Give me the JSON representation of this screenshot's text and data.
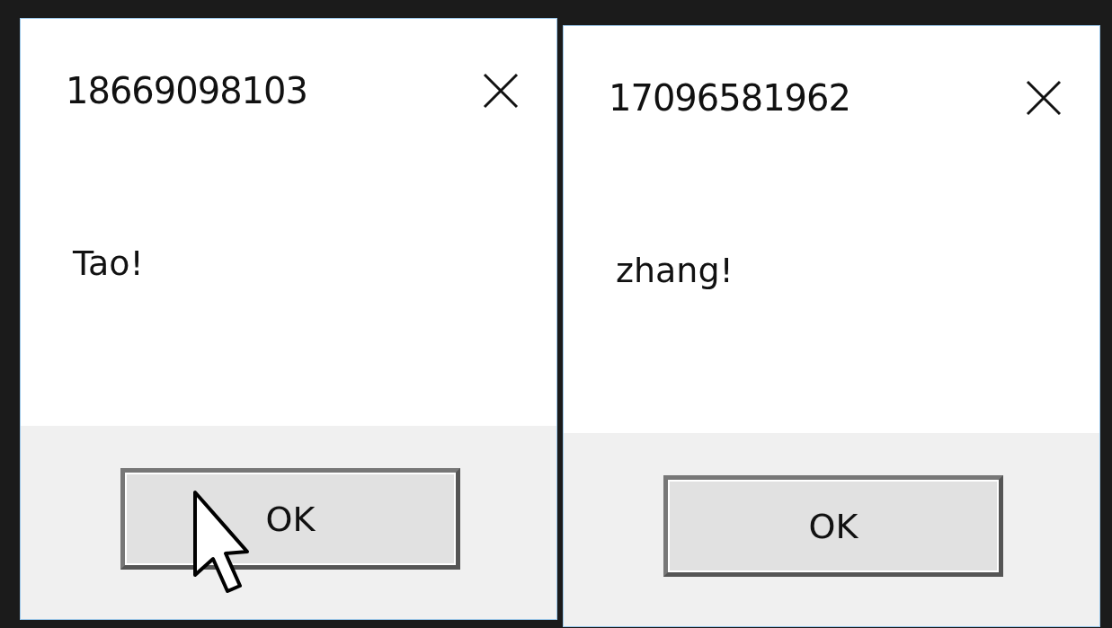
{
  "dialogs": [
    {
      "title": "18669098103",
      "message": "Tao!",
      "button": "OK",
      "cursor_over_button": true
    },
    {
      "title": "17096581962",
      "message": "zhang!",
      "button": "OK",
      "cursor_over_button": false
    }
  ]
}
